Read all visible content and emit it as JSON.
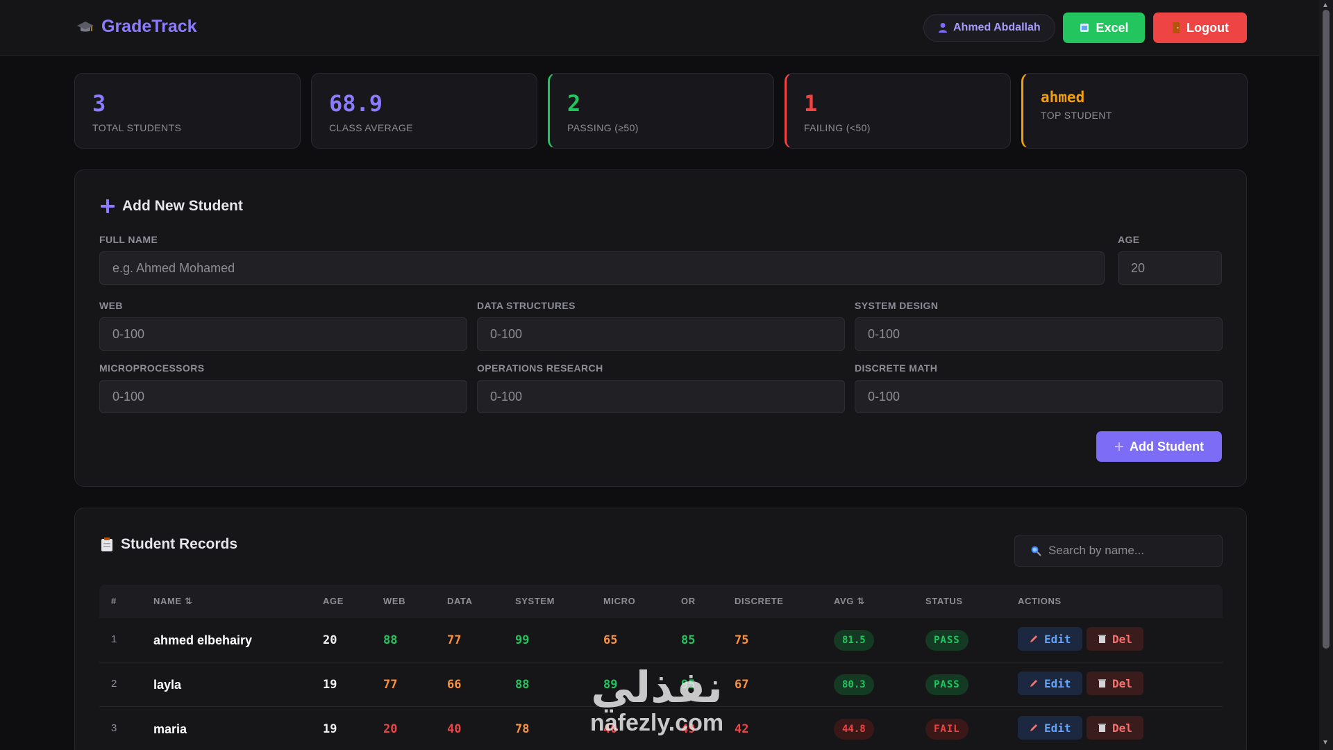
{
  "app": {
    "name": "GradeTrack"
  },
  "header": {
    "user_name": "Ahmed Abdallah",
    "excel_label": "Excel",
    "logout_label": "Logout"
  },
  "stats": [
    {
      "value": "3",
      "label": "TOTAL STUDENTS",
      "color": "#8b7cff"
    },
    {
      "value": "68.9",
      "label": "CLASS AVERAGE",
      "color": "#8b7cff"
    },
    {
      "value": "2",
      "label": "PASSING (≥50)",
      "color": "#22c55e"
    },
    {
      "value": "1",
      "label": "FAILING (<50)",
      "color": "#ef4444"
    },
    {
      "value": "ahmed",
      "label": "TOP STUDENT",
      "color": "#f59e0b"
    }
  ],
  "form": {
    "title": "Add New Student",
    "full_name_label": "FULL NAME",
    "full_name_placeholder": "e.g. Ahmed Mohamed",
    "age_label": "AGE",
    "age_placeholder": "20",
    "subjects": [
      {
        "label": "WEB",
        "placeholder": "0-100"
      },
      {
        "label": "DATA STRUCTURES",
        "placeholder": "0-100"
      },
      {
        "label": "SYSTEM DESIGN",
        "placeholder": "0-100"
      },
      {
        "label": "MICROPROCESSORS",
        "placeholder": "0-100"
      },
      {
        "label": "OPERATIONS RESEARCH",
        "placeholder": "0-100"
      },
      {
        "label": "DISCRETE MATH",
        "placeholder": "0-100"
      }
    ],
    "submit_label": "Add Student"
  },
  "records": {
    "title": "Student Records",
    "search_placeholder": "Search by name...",
    "columns": [
      "#",
      "NAME ⇅",
      "AGE",
      "WEB",
      "DATA",
      "SYSTEM",
      "MICRO",
      "OR",
      "DISCRETE",
      "AVG ⇅",
      "STATUS",
      "ACTIONS"
    ],
    "edit_label": "Edit",
    "del_label": "Del",
    "rows": [
      {
        "idx": "1",
        "name": "ahmed elbehairy",
        "age": "20",
        "web": "88",
        "data": "77",
        "system": "99",
        "micro": "65",
        "or": "85",
        "discrete": "75",
        "avg": "81.5",
        "status": "PASS"
      },
      {
        "idx": "2",
        "name": "layla",
        "age": "19",
        "web": "77",
        "data": "66",
        "system": "88",
        "micro": "89",
        "or": "95",
        "discrete": "67",
        "avg": "80.3",
        "status": "PASS"
      },
      {
        "idx": "3",
        "name": "maria",
        "age": "19",
        "web": "20",
        "data": "40",
        "system": "78",
        "micro": "40",
        "or": "49",
        "discrete": "42",
        "avg": "44.8",
        "status": "FAIL"
      }
    ]
  },
  "watermark": {
    "logo_text": "نفذلي",
    "url": "nafezly.com"
  }
}
